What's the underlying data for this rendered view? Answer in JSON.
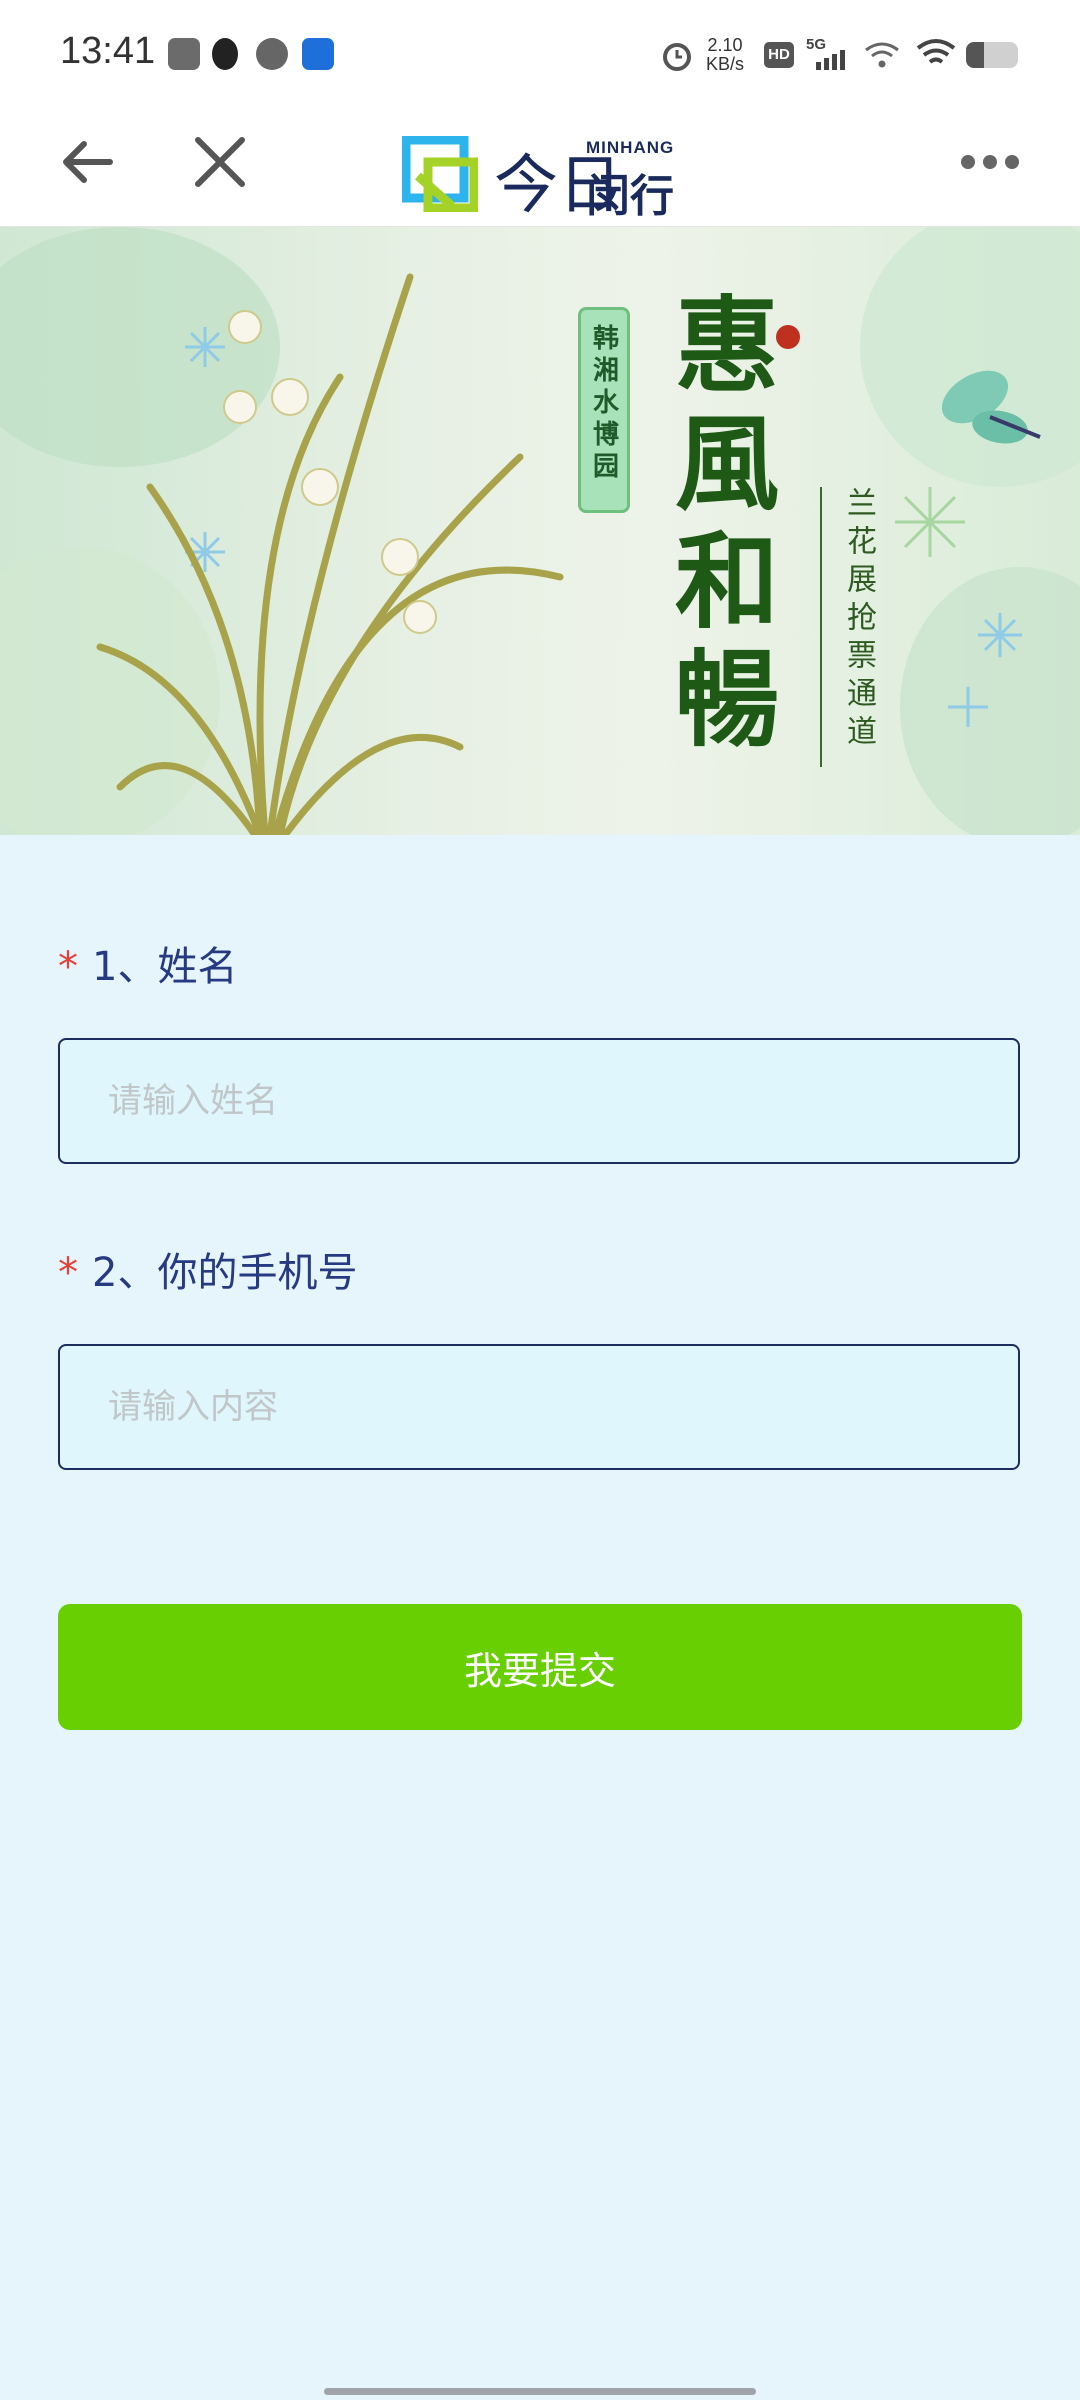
{
  "status_bar": {
    "time": "13:41",
    "speed_top": "2.10",
    "speed_unit": "KB/s",
    "hd": "HD",
    "network": "5G",
    "icons": [
      "sim-card-icon",
      "qq-icon",
      "chat-bubble-icon",
      "app-icon",
      "alarm-icon",
      "hd-icon",
      "signal-5g-icon",
      "wifi-icon",
      "battery-icon"
    ]
  },
  "nav": {
    "logo_main": "闵行",
    "logo_jin": "今日",
    "logo_sub": "MINHANG",
    "icons": [
      "back-arrow-icon",
      "close-icon",
      "more-icon"
    ]
  },
  "banner": {
    "tag": "韩湘水博园",
    "title_chars": [
      "惠",
      "風",
      "和",
      "暢"
    ],
    "subtitle": "兰花展抢票通道"
  },
  "form": {
    "q1_label": "1、姓名",
    "q1_placeholder": "请输入姓名",
    "q2_label": "2、你的手机号",
    "q2_placeholder": "请输入内容",
    "required_mark": "*",
    "submit_label": "我要提交"
  },
  "colors": {
    "accent_green": "#67cf02",
    "label_blue": "#253a80",
    "required_red": "#e5403a",
    "page_bg": "#e6f4fb",
    "input_bg": "#dff6fc"
  }
}
